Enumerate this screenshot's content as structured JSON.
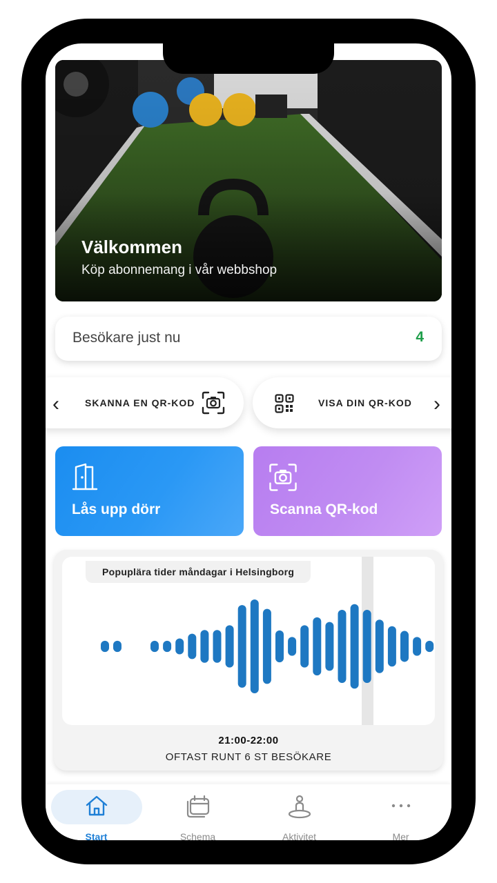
{
  "hero": {
    "title": "Välkommen",
    "subtitle": "Köp abonnemang i vår webbshop"
  },
  "visitors": {
    "label": "Besökare just nu",
    "count": "4",
    "count_color": "#1e9e4a"
  },
  "qr": {
    "scan_label": "SKANNA EN QR-KOD",
    "show_label": "VISA DIN QR-KOD",
    "prev_icon": "chevron-left-icon",
    "next_icon": "chevron-right-icon"
  },
  "actions": {
    "unlock_label": "Lås upp dörr",
    "unlock_icon": "door-icon",
    "unlock_color": "#2a98f5",
    "scan_label": "Scanna QR-kod",
    "scan_icon": "camera-scan-icon",
    "scan_color": "#c08cf2"
  },
  "popular": {
    "title": "Popuplära tider måndagar i Helsingborg",
    "time_range": "21:00-22:00",
    "description": "OFTAST RUNT 6 ST BESÖKARE",
    "bar_color": "#1e78c2",
    "bars": [
      0.12,
      0.12,
      0.12,
      0.12,
      0.17,
      0.27,
      0.35,
      0.35,
      0.45,
      0.88,
      1.0,
      0.8,
      0.34,
      0.2,
      0.45,
      0.62,
      0.52,
      0.78,
      0.9,
      0.78,
      0.57,
      0.43,
      0.33,
      0.2,
      0.12
    ]
  },
  "nav": {
    "items": [
      {
        "label": "Start",
        "icon": "home-icon",
        "active": true
      },
      {
        "label": "Schema",
        "icon": "calendar-icon",
        "active": false
      },
      {
        "label": "Aktivitet",
        "icon": "activity-person-icon",
        "active": false
      },
      {
        "label": "Mer",
        "icon": "more-dots-icon",
        "active": false
      }
    ],
    "active_color": "#1e7fd6"
  }
}
